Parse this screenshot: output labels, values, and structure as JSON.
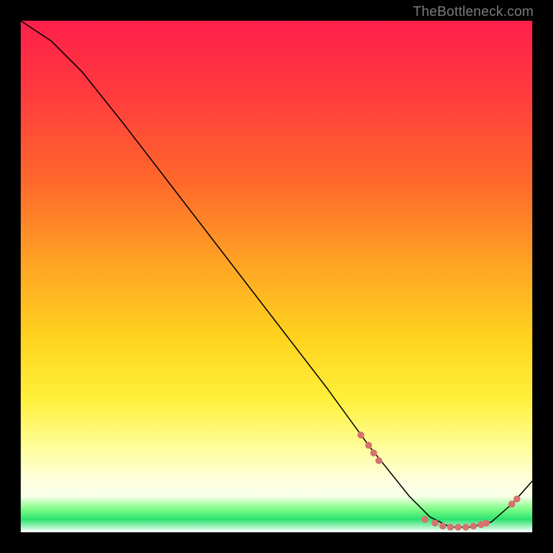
{
  "chart_data": {
    "type": "line",
    "watermark": "TheBottleneck.com",
    "x_range": [
      0,
      100
    ],
    "y_range": [
      0,
      100
    ],
    "curve": {
      "x": [
        0,
        6,
        12,
        20,
        30,
        40,
        50,
        60,
        68,
        72,
        76,
        80,
        84,
        88,
        92,
        96,
        100
      ],
      "y": [
        100,
        96,
        90,
        80,
        67,
        54,
        41,
        28,
        17,
        12,
        7,
        3,
        1,
        1,
        2,
        5.5,
        10
      ]
    },
    "scatter_points": [
      {
        "x": 66.5,
        "y": 19
      },
      {
        "x": 68,
        "y": 17
      },
      {
        "x": 69,
        "y": 15.5
      },
      {
        "x": 70,
        "y": 14
      },
      {
        "x": 79,
        "y": 2.5
      },
      {
        "x": 81,
        "y": 1.8
      },
      {
        "x": 82.5,
        "y": 1.2
      },
      {
        "x": 84,
        "y": 1
      },
      {
        "x": 85.5,
        "y": 1
      },
      {
        "x": 87,
        "y": 1
      },
      {
        "x": 88.5,
        "y": 1.2
      },
      {
        "x": 90,
        "y": 1.5
      },
      {
        "x": 91,
        "y": 1.8
      },
      {
        "x": 96,
        "y": 5.5
      },
      {
        "x": 97,
        "y": 6.5
      }
    ],
    "point_color": "#d6726f",
    "point_radius_px": 5
  }
}
